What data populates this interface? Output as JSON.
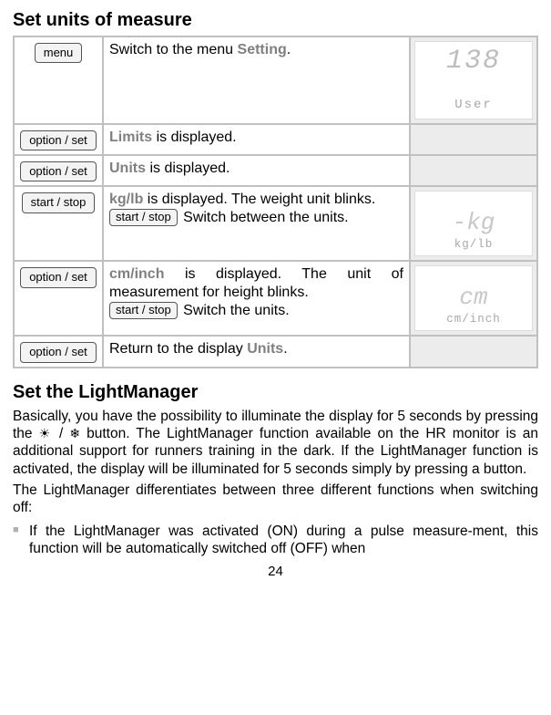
{
  "heading1": "Set units of measure",
  "rows": {
    "r1": {
      "button": "menu",
      "text_prefix": "Switch to the menu ",
      "text_emph": "Setting",
      "text_suffix": ".",
      "display_top": "138",
      "display_bottom": "User"
    },
    "r2": {
      "button": "option / set",
      "lead": "Limits",
      "rest": " is displayed."
    },
    "r3": {
      "button": "option / set",
      "lead": "Units",
      "rest": " is displayed."
    },
    "r4": {
      "button": "start / stop",
      "lead": "kg/lb",
      "rest": " is displayed. The weight unit blinks.",
      "inline_button": "start / stop",
      "inline_rest": " Switch between the units.",
      "display_icon": "-kg",
      "display_bottom": "kg/lb"
    },
    "r5": {
      "button": "option / set",
      "lead": "cm/inch",
      "rest": " is displayed. The unit of measurement for height blinks.",
      "inline_button": "start / stop",
      "inline_rest": " Switch the units.",
      "display_icon": "cm",
      "display_bottom": "cm/inch"
    },
    "r6": {
      "button": "option / set",
      "text_prefix": "Return to the display ",
      "text_emph": "Units",
      "text_suffix": "."
    }
  },
  "heading2": "Set the LightManager",
  "lightmanager": {
    "p1a": "Basically, you have the possibility to illuminate the display for 5 seconds by pressing the ",
    "icon1": "☀",
    "sep": " / ",
    "icon2": "❄",
    "p1b": " button. The LightManager function available on the HR monitor is an additional support for runners training in the dark. If the LightManager function is activated, the display will be illuminated for 5 seconds simply by pressing a button.",
    "p2": "The LightManager differentiates between three different functions when switching off:",
    "bullet1": "If the LightManager was activated (ON) during a pulse measure-ment, this function will be automatically switched off (OFF) when"
  },
  "page_number": "24"
}
